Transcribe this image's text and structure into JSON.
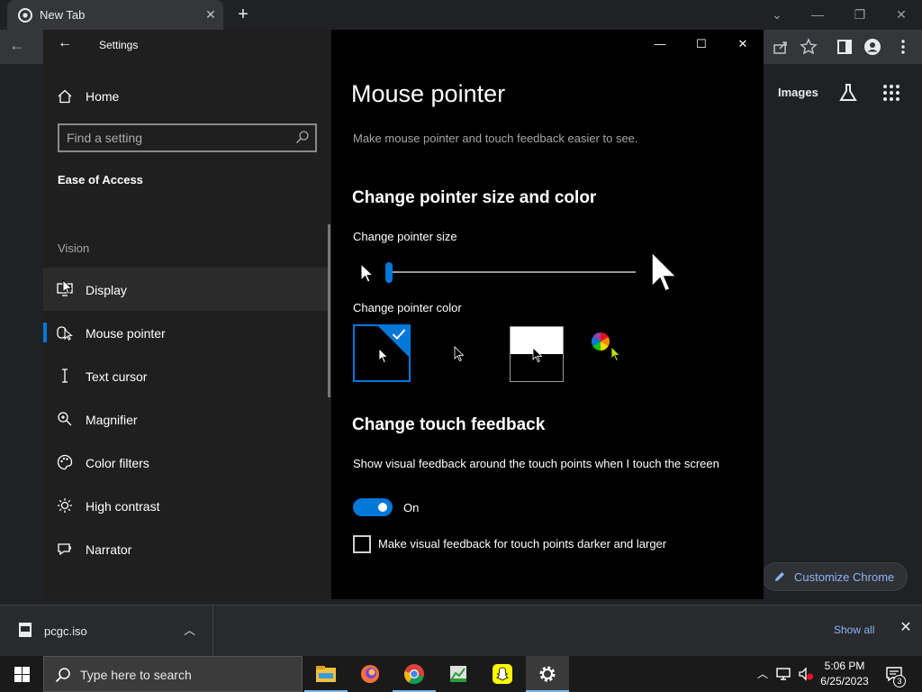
{
  "browser": {
    "tab_title": "New Tab",
    "images_link": "Images",
    "customize_label": "Customize Chrome"
  },
  "download_bar": {
    "file_name": "pcgc.iso",
    "show_all": "Show all"
  },
  "taskbar": {
    "search_placeholder": "Type here to search",
    "time": "5:06 PM",
    "date": "6/25/2023",
    "notification_count": "3"
  },
  "settings": {
    "window_title": "Settings",
    "home_label": "Home",
    "search_placeholder": "Find a setting",
    "category": "Ease of Access",
    "group_vision": "Vision",
    "nav_items": [
      {
        "label": "Display",
        "icon": "display-icon"
      },
      {
        "label": "Mouse pointer",
        "icon": "mouse-pointer-icon"
      },
      {
        "label": "Text cursor",
        "icon": "text-cursor-icon"
      },
      {
        "label": "Magnifier",
        "icon": "magnifier-icon"
      },
      {
        "label": "Color filters",
        "icon": "color-filters-icon"
      },
      {
        "label": "High contrast",
        "icon": "high-contrast-icon"
      },
      {
        "label": "Narrator",
        "icon": "narrator-icon"
      }
    ],
    "page_title": "Mouse pointer",
    "page_description": "Make mouse pointer and touch feedback easier to see.",
    "section_pointer_title": "Change pointer size and color",
    "pointer_size_label": "Change pointer size",
    "pointer_size_value": 1,
    "pointer_size_max": 15,
    "pointer_color_label": "Change pointer color",
    "pointer_color_selected": "white",
    "section_touch_title": "Change touch feedback",
    "touch_feedback_label": "Show visual feedback around the touch points when I touch the screen",
    "touch_feedback_state": "On",
    "darker_feedback_label": "Make visual feedback for touch points darker and larger",
    "darker_feedback_checked": false
  },
  "colors": {
    "accent": "#0078d7",
    "sidebar_bg": "#1f1f1f",
    "content_bg": "#000000",
    "chrome_bg": "#202124",
    "chrome_link": "#8ab4f8"
  }
}
